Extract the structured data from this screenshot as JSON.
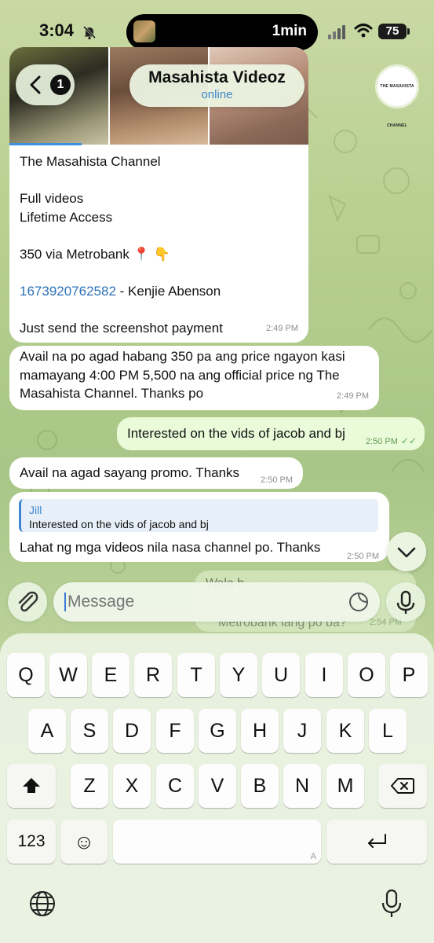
{
  "status_bar": {
    "time": "3:04",
    "activity_label": "1min",
    "battery": "75"
  },
  "header": {
    "back_badge": "1",
    "title": "Masahista Videoz",
    "subtitle": "online",
    "avatar_text": "THE MASAHISTA CHANNEL"
  },
  "messages": {
    "m1_lines": [
      "The Masahista Channel",
      "",
      "Full videos",
      "Lifetime Access",
      "",
      "350 via Metrobank 📍 👇",
      "",
      "",
      "",
      "Just send the screenshot payment"
    ],
    "m1_account": "1673920762582",
    "m1_account_suffix": " - Kenjie Abenson",
    "m1_time": "2:49 PM",
    "m2_text": "Avail na po agad habang 350 pa ang price ngayon kasi mamayang 4:00 PM 5,500 na ang official price ng The Masahista Channel. Thanks po",
    "m2_time": "2:49 PM",
    "m3_text": "Interested on the vids of jacob and bj",
    "m3_time": "2:50 PM",
    "m4_text": "Avail na agad sayang promo. Thanks",
    "m4_time": "2:50 PM",
    "m5_reply_name": "Jill",
    "m5_reply_text": "Interested on the vids of jacob and bj",
    "m5_text": "Lahat ng mga videos nila nasa channel po. Thanks",
    "m5_time": "2:50 PM",
    "m6_line1": "Wala b...",
    "m6_line2": "Metrobank lang po ba?",
    "m6_time": "2:54 PM"
  },
  "input": {
    "placeholder": "Message"
  },
  "keyboard": {
    "row1": [
      "Q",
      "W",
      "E",
      "R",
      "T",
      "Y",
      "U",
      "I",
      "O",
      "P"
    ],
    "row2": [
      "A",
      "S",
      "D",
      "F",
      "G",
      "H",
      "J",
      "K",
      "L"
    ],
    "row3": [
      "Z",
      "X",
      "C",
      "V",
      "B",
      "N",
      "M"
    ],
    "numbers_key": "123",
    "emoji_key": "☺",
    "space_hint": "A"
  },
  "icons": {
    "back": "chevron-left-icon",
    "bell_muted": "bell-slash-icon",
    "attach": "paperclip-icon",
    "sticker": "sticker-icon",
    "mic": "microphone-icon",
    "scroll": "chevron-down-icon",
    "shift": "shift-icon",
    "delete": "delete-icon",
    "return": "return-icon",
    "globe": "globe-icon",
    "dictation": "microphone-icon"
  },
  "colors": {
    "link": "#2e72b8",
    "online": "#3b88c8",
    "outgoing_bubble": "#eafbd9",
    "checkmarks": "#5fa857"
  }
}
